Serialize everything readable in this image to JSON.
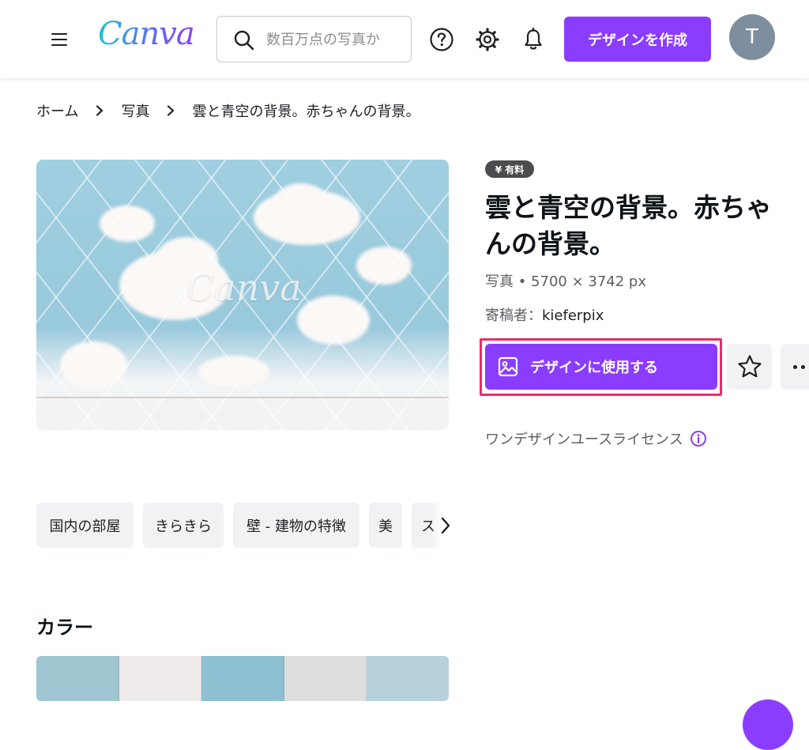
{
  "header": {
    "logo_text": "Canva",
    "search_placeholder": "数百万点の写真か",
    "create_label": "デザインを作成",
    "avatar_initial": "T"
  },
  "breadcrumb": {
    "items": [
      "ホーム",
      "写真",
      "雲と青空の背景。赤ちゃんの背景。"
    ]
  },
  "image": {
    "watermark": "Canva"
  },
  "details": {
    "badge": "¥ 有料",
    "title": "雲と青空の背景。赤ちゃんの背景。",
    "type_and_size": "写真 • 5700 × 3742 px",
    "contributor_label": "寄稿者：",
    "contributor": "kieferpix",
    "use_in_design_label": "デザインに使用する",
    "license": "ワンデザインユースライセンス"
  },
  "tags": [
    "国内の部屋",
    "きらきら",
    "壁 - 建物の特徴",
    "美",
    "ス"
  ],
  "colors": {
    "title": "カラー",
    "swatches": [
      "#9fc6d1",
      "#efebea",
      "#8dc0d0",
      "#dedede",
      "#b7d2da"
    ]
  },
  "theme": {
    "accent": "#8b3dff",
    "highlight_border": "#ea2c6d"
  }
}
